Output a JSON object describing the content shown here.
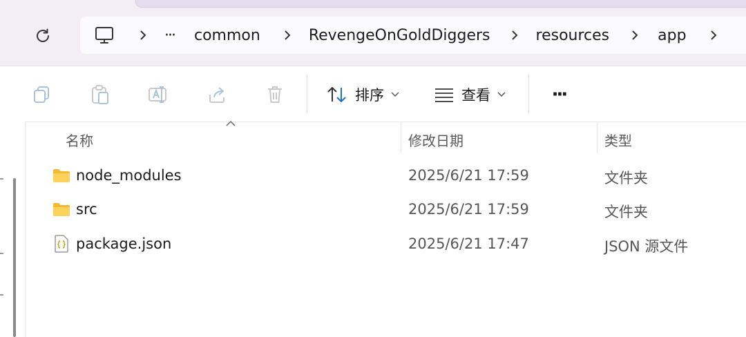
{
  "address_bar": {
    "overflow_label": "···",
    "crumbs": [
      "common",
      "RevengeOnGoldDiggers",
      "resources",
      "app"
    ]
  },
  "toolbar": {
    "sort_label": "排序",
    "view_label": "查看",
    "more_label": "···"
  },
  "columns": {
    "name": "名称",
    "modified": "修改日期",
    "type": "类型"
  },
  "files": [
    {
      "name": "node_modules",
      "modified": "2025/6/21 17:59",
      "type": "文件夹",
      "icon": "folder-icon"
    },
    {
      "name": "src",
      "modified": "2025/6/21 17:59",
      "type": "文件夹",
      "icon": "folder-icon"
    },
    {
      "name": "package.json",
      "modified": "2025/6/21 17:47",
      "type": "JSON 源文件",
      "icon": "json-file-icon"
    }
  ],
  "colors": {
    "folder": "#f8c53a",
    "accent": "#1a73c8",
    "disabled_icon": "#b9c9dd"
  }
}
